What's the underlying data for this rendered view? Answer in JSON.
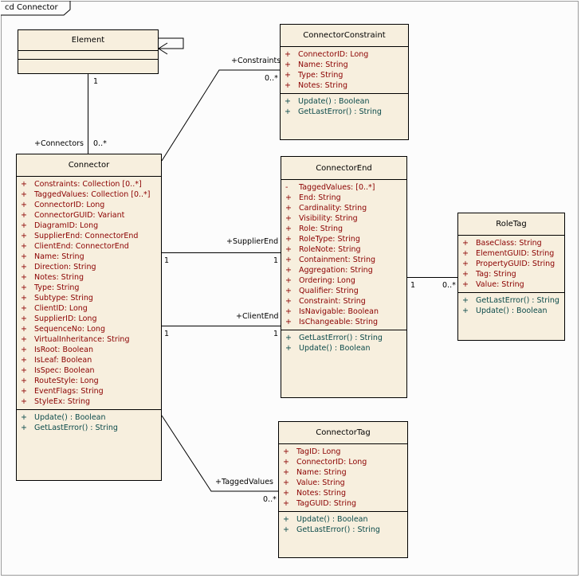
{
  "diagram_title": "cd Connector",
  "classes": {
    "element": {
      "name": "Element",
      "attributes": [],
      "operations": []
    },
    "connector_constraint": {
      "name": "ConnectorConstraint",
      "attributes": [
        {
          "vis": "+",
          "text": "ConnectorID:  Long"
        },
        {
          "vis": "+",
          "text": "Name:  String"
        },
        {
          "vis": "+",
          "text": "Type:  String"
        },
        {
          "vis": "+",
          "text": "Notes:  String"
        }
      ],
      "operations": [
        {
          "vis": "+",
          "text": "Update() : Boolean"
        },
        {
          "vis": "+",
          "text": "GetLastError() : String"
        }
      ]
    },
    "connector": {
      "name": "Connector",
      "attributes": [
        {
          "vis": "+",
          "text": "Constraints:  Collection [0..*]"
        },
        {
          "vis": "+",
          "text": "TaggedValues:  Collection [0..*]"
        },
        {
          "vis": "+",
          "text": "ConnectorID:  Long"
        },
        {
          "vis": "+",
          "text": "ConnectorGUID:  Variant"
        },
        {
          "vis": "+",
          "text": "DiagramID:  Long"
        },
        {
          "vis": "+",
          "text": "SupplierEnd:  ConnectorEnd"
        },
        {
          "vis": "+",
          "text": "ClientEnd:  ConnectorEnd"
        },
        {
          "vis": "+",
          "text": "Name:  String"
        },
        {
          "vis": "+",
          "text": "Direction:  String"
        },
        {
          "vis": "+",
          "text": "Notes:  String"
        },
        {
          "vis": "+",
          "text": "Type:  String"
        },
        {
          "vis": "+",
          "text": "Subtype:  String"
        },
        {
          "vis": "+",
          "text": "ClientID:  Long"
        },
        {
          "vis": "+",
          "text": "SupplierID:  Long"
        },
        {
          "vis": "+",
          "text": "SequenceNo:  Long"
        },
        {
          "vis": "+",
          "text": "VirtualInheritance:  String"
        },
        {
          "vis": "+",
          "text": "IsRoot:  Boolean"
        },
        {
          "vis": "+",
          "text": "IsLeaf:  Boolean"
        },
        {
          "vis": "+",
          "text": "IsSpec:  Boolean"
        },
        {
          "vis": "+",
          "text": "RouteStyle:  Long"
        },
        {
          "vis": "+",
          "text": "EventFlags:  String"
        },
        {
          "vis": "+",
          "text": "StyleEx:  String"
        }
      ],
      "operations": [
        {
          "vis": "+",
          "text": "Update() : Boolean"
        },
        {
          "vis": "+",
          "text": "GetLastError() : String"
        }
      ]
    },
    "connector_end": {
      "name": "ConnectorEnd",
      "attributes": [
        {
          "vis": "-",
          "text": "TaggedValues:   [0..*]"
        },
        {
          "vis": "+",
          "text": "End:  String"
        },
        {
          "vis": "+",
          "text": "Cardinality:  String"
        },
        {
          "vis": "+",
          "text": "Visibility:  String"
        },
        {
          "vis": "+",
          "text": "Role:  String"
        },
        {
          "vis": "+",
          "text": "RoleType:  String"
        },
        {
          "vis": "+",
          "text": "RoleNote:  String"
        },
        {
          "vis": "+",
          "text": "Containment:  String"
        },
        {
          "vis": "+",
          "text": "Aggregation:  String"
        },
        {
          "vis": "+",
          "text": "Ordering:  Long"
        },
        {
          "vis": "+",
          "text": "Qualifier:  String"
        },
        {
          "vis": "+",
          "text": "Constraint:  String"
        },
        {
          "vis": "+",
          "text": "IsNavigable:  Boolean"
        },
        {
          "vis": "+",
          "text": "IsChangeable:  String"
        }
      ],
      "operations": [
        {
          "vis": "+",
          "text": "GetLastError() : String"
        },
        {
          "vis": "+",
          "text": "Update() : Boolean"
        }
      ]
    },
    "role_tag": {
      "name": "RoleTag",
      "attributes": [
        {
          "vis": "+",
          "text": "BaseClass:  String"
        },
        {
          "vis": "+",
          "text": "ElementGUID:  String"
        },
        {
          "vis": "+",
          "text": "PropertyGUID:  String"
        },
        {
          "vis": "+",
          "text": "Tag:  String"
        },
        {
          "vis": "+",
          "text": "Value:  String"
        }
      ],
      "operations": [
        {
          "vis": "+",
          "text": "GetLastError() : String"
        },
        {
          "vis": "+",
          "text": "Update() : Boolean"
        }
      ]
    },
    "connector_tag": {
      "name": "ConnectorTag",
      "attributes": [
        {
          "vis": "+",
          "text": "TagID:  Long"
        },
        {
          "vis": "+",
          "text": "ConnectorID:  Long"
        },
        {
          "vis": "+",
          "text": "Name:  String"
        },
        {
          "vis": "+",
          "text": "Value:  String"
        },
        {
          "vis": "+",
          "text": "Notes:  String"
        },
        {
          "vis": "+",
          "text": "TagGUID:  String"
        }
      ],
      "operations": [
        {
          "vis": "+",
          "text": "Update() : Boolean"
        },
        {
          "vis": "+",
          "text": "GetLastError() : String"
        }
      ]
    }
  },
  "association_labels": {
    "element_mult": "1",
    "connectors_role": "+Connectors",
    "connectors_mult": "0..*",
    "constraints_role": "+Constraints",
    "constraints_mult": "0..*",
    "supplier_role": "+SupplierEnd",
    "supplier_mult_left": "1",
    "supplier_mult_right": "1",
    "client_role": "+ClientEnd",
    "client_mult_left": "1",
    "client_mult_right": "1",
    "roletag_mult_left": "1",
    "roletag_mult_right": "0..*",
    "tagged_role": "+TaggedValues",
    "tagged_mult": "0..*"
  }
}
